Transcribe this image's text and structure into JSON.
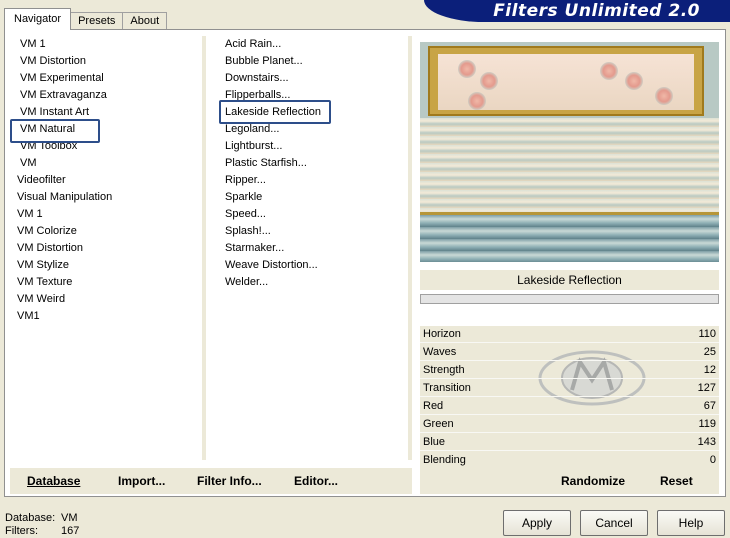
{
  "tabs": [
    {
      "label": "Navigator",
      "active": true
    },
    {
      "label": "Presets",
      "active": false
    },
    {
      "label": "About",
      "active": false
    }
  ],
  "banner_title": "Filters Unlimited 2.0",
  "categories": [
    "VM 1",
    "VM Distortion",
    "VM Experimental",
    "VM Extravaganza",
    "VM Instant Art",
    "VM Natural",
    "VM Toolbox",
    "VM",
    "Videofilter",
    "Visual Manipulation",
    "VM 1",
    "VM Colorize",
    "VM Distortion",
    "VM Stylize",
    "VM Texture",
    "VM Weird",
    "VM1"
  ],
  "selected_category": "VM Natural",
  "filters": [
    "Acid Rain...",
    "Bubble Planet...",
    "Downstairs...",
    "Flipperballs...",
    "Lakeside Reflection",
    "Legoland...",
    "Lightburst...",
    "Plastic Starfish...",
    "Ripper...",
    "Sparkle",
    "Speed...",
    "Splash!...",
    "Starmaker...",
    "Weave Distortion...",
    "Welder..."
  ],
  "selected_filter": "Lakeside Reflection",
  "filter_name": "Lakeside Reflection",
  "parameters": [
    {
      "label": "Horizon",
      "value": "110"
    },
    {
      "label": "Waves",
      "value": "25"
    },
    {
      "label": "Strength",
      "value": "12"
    },
    {
      "label": "Transition",
      "value": "127"
    },
    {
      "label": "Red",
      "value": "67"
    },
    {
      "label": "Green",
      "value": "119"
    },
    {
      "label": "Blue",
      "value": "143"
    },
    {
      "label": "Blending",
      "value": "0"
    }
  ],
  "toolbar": {
    "database": "Database",
    "import": "Import...",
    "filter_info": "Filter Info...",
    "editor": "Editor...",
    "randomize": "Randomize",
    "reset": "Reset"
  },
  "status": {
    "database_label": "Database:",
    "database_value": "VM",
    "filters_label": "Filters:",
    "filters_value": "167"
  },
  "buttons": {
    "apply": "Apply",
    "cancel": "Cancel",
    "help": "Help"
  },
  "colors": {
    "banner": "#0b1f7a",
    "selection": "#2d4e8a",
    "frame": "#c8a445"
  }
}
